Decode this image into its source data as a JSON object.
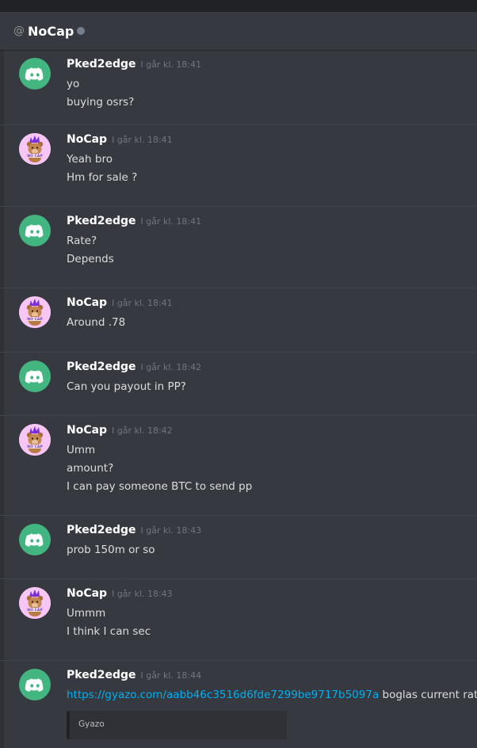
{
  "header": {
    "at_symbol": "@",
    "channel_name": "NoCap"
  },
  "messages": [
    {
      "author": "Pked2edge",
      "avatar": "discord",
      "timestamp": "I går kl. 18:41",
      "lines": [
        "yo",
        "buying osrs?"
      ]
    },
    {
      "author": "NoCap",
      "avatar": "nocap",
      "timestamp": "I går kl. 18:41",
      "lines": [
        "Yeah bro",
        "Hm for sale ?"
      ]
    },
    {
      "author": "Pked2edge",
      "avatar": "discord",
      "timestamp": "I går kl. 18:41",
      "lines": [
        "Rate?",
        "Depends"
      ]
    },
    {
      "author": "NoCap",
      "avatar": "nocap",
      "timestamp": "I går kl. 18:41",
      "lines": [
        "Around .78"
      ]
    },
    {
      "author": "Pked2edge",
      "avatar": "discord",
      "timestamp": "I går kl. 18:42",
      "lines": [
        "Can you payout in PP?"
      ]
    },
    {
      "author": "NoCap",
      "avatar": "nocap",
      "timestamp": "I går kl. 18:42",
      "lines": [
        "Umm",
        "amount?",
        "I can pay someone BTC to send pp"
      ]
    },
    {
      "author": "Pked2edge",
      "avatar": "discord",
      "timestamp": "I går kl. 18:43",
      "lines": [
        "prob 150m or so"
      ]
    },
    {
      "author": "NoCap",
      "avatar": "nocap",
      "timestamp": "I går kl. 18:43",
      "lines": [
        "Ummm",
        "I think I can sec"
      ]
    },
    {
      "author": "Pked2edge",
      "avatar": "discord",
      "timestamp": "I går kl. 18:44",
      "link": "https://gyazo.com/aabb46c3516d6fde7299be9717b5097a",
      "link_suffix": " boglas current rate",
      "embed_provider": "Gyazo"
    }
  ],
  "colors": {
    "background": "#36393f",
    "link": "#00b0f4",
    "discord_avatar": "#43b581",
    "nocap_avatar": "#f2a4f0"
  }
}
